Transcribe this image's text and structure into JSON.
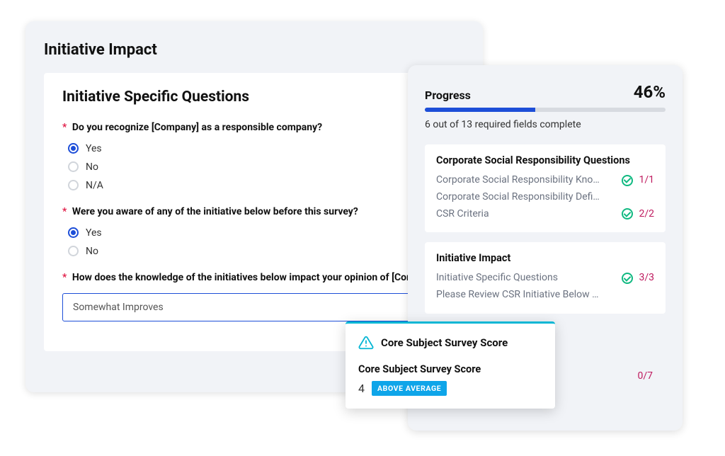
{
  "leftPanel": {
    "title": "Initiative Impact",
    "sectionTitle": "Initiative Specific Questions",
    "questions": [
      {
        "label": "Do you recognize [Company] as a responsible company?",
        "options": [
          "Yes",
          "No",
          "N/A"
        ],
        "selected": "Yes"
      },
      {
        "label": "Were you aware of any of the initiative below before this survey?",
        "options": [
          "Yes",
          "No"
        ],
        "selected": "Yes"
      },
      {
        "label": "How does the knowledge of the initiatives below impact your opinion of [Company]?",
        "selectValue": "Somewhat Improves"
      }
    ]
  },
  "rightPanel": {
    "progressTitle": "Progress",
    "percent": "46%",
    "percentNum": 46,
    "subtitle": "6 out of 13 required fields complete",
    "sections": [
      {
        "title": "Corporate Social Responsibility Questions",
        "rows": [
          {
            "name": "Corporate Social Responsibility Knowl...",
            "done": true,
            "count": "1/1"
          },
          {
            "name": "Corporate Social Responsibility Definition",
            "done": false,
            "count": ""
          },
          {
            "name": "CSR Criteria",
            "done": true,
            "count": "2/2"
          }
        ]
      },
      {
        "title": "Initiative Impact",
        "rows": [
          {
            "name": "Initiative Specific Questions",
            "done": true,
            "count": "3/3"
          },
          {
            "name": "Please Review CSR Initiative Below Before Com...",
            "done": false,
            "count": ""
          }
        ]
      }
    ],
    "trailingCount": "0/7"
  },
  "scoreCard": {
    "headTitle": "Core Subject Survey Score",
    "subTitle": "Core Subject Survey Score",
    "value": "4",
    "badge": "ABOVE AVERAGE"
  }
}
